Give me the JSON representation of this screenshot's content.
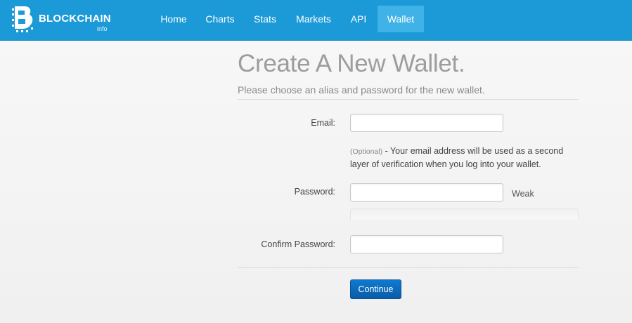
{
  "brand": {
    "name": "BLOCKCHAIN",
    "sub": "info",
    "color": "#1b9ad7"
  },
  "nav": {
    "items": [
      {
        "label": "Home"
      },
      {
        "label": "Charts"
      },
      {
        "label": "Stats"
      },
      {
        "label": "Markets"
      },
      {
        "label": "API"
      },
      {
        "label": "Wallet",
        "active": true
      }
    ]
  },
  "page": {
    "title": "Create A New Wallet.",
    "subtitle": "Please choose an alias and password for the new wallet."
  },
  "form": {
    "email": {
      "label": "Email:",
      "value": "",
      "placeholder": ""
    },
    "email_help": {
      "optional": "(Optional)",
      "text": " - Your email address will be used as a second layer of verification when you log into your wallet."
    },
    "password": {
      "label": "Password:",
      "value": "",
      "placeholder": "",
      "strength": "Weak"
    },
    "confirm": {
      "label": "Confirm Password:",
      "value": "",
      "placeholder": ""
    },
    "submit_label": "Continue"
  }
}
